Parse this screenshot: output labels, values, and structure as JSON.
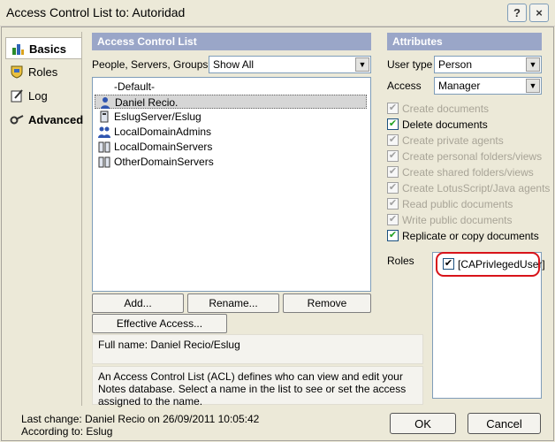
{
  "window": {
    "title": "Access Control List to: Autoridad"
  },
  "titlebar_buttons": {
    "help": "?",
    "close": "×"
  },
  "sidebar": {
    "items": [
      {
        "label": "Basics",
        "active": true
      },
      {
        "label": "Roles",
        "active": false
      },
      {
        "label": "Log",
        "active": false
      },
      {
        "label": "Advanced",
        "active": false
      }
    ]
  },
  "acl": {
    "header": "Access Control List",
    "filter_label": "People, Servers, Groups",
    "filter_value": "Show All",
    "entries": [
      {
        "label": "-Default-",
        "icon": "none-icon",
        "selected": false
      },
      {
        "label": "Daniel Recio.",
        "icon": "person-icon",
        "selected": true
      },
      {
        "label": "EslugServer/Eslug",
        "icon": "server-icon",
        "selected": false
      },
      {
        "label": "LocalDomainAdmins",
        "icon": "group-icon",
        "selected": false
      },
      {
        "label": "LocalDomainServers",
        "icon": "server-group-icon",
        "selected": false
      },
      {
        "label": "OtherDomainServers",
        "icon": "server-group-icon",
        "selected": false
      }
    ],
    "buttons": {
      "add": "Add...",
      "rename": "Rename...",
      "remove": "Remove",
      "effective": "Effective Access..."
    },
    "full_name": "Full name: Daniel Recio/Eslug",
    "description": "An Access Control List (ACL) defines who can view and edit your Notes database.  Select a name in the list to see or set the access assigned to the name."
  },
  "attributes": {
    "header": "Attributes",
    "user_type_label": "User type",
    "user_type_value": "Person",
    "access_label": "Access",
    "access_value": "Manager",
    "options": [
      {
        "label": "Create documents",
        "checked": true,
        "enabled": false
      },
      {
        "label": "Delete documents",
        "checked": true,
        "enabled": true
      },
      {
        "label": "Create private agents",
        "checked": true,
        "enabled": false
      },
      {
        "label": "Create personal folders/views",
        "checked": true,
        "enabled": false
      },
      {
        "label": "Create shared folders/views",
        "checked": true,
        "enabled": false
      },
      {
        "label": "Create LotusScript/Java agents",
        "checked": true,
        "enabled": false
      },
      {
        "label": "Read public documents",
        "checked": true,
        "enabled": false
      },
      {
        "label": "Write public documents",
        "checked": true,
        "enabled": false
      },
      {
        "label": "Replicate or copy documents",
        "checked": true,
        "enabled": true
      }
    ],
    "roles_label": "Roles",
    "roles": [
      {
        "label": "[CAPrivlegedUser]",
        "checked": true
      }
    ]
  },
  "footer": {
    "last_change": "Last change: Daniel Recio on 26/09/2011 10:05:42",
    "according_to": "According to: Eslug",
    "ok": "OK",
    "cancel": "Cancel"
  },
  "colors": {
    "header_bar": "#9aa6c8",
    "highlight_ring": "#d8141a",
    "check": "#21a121"
  }
}
